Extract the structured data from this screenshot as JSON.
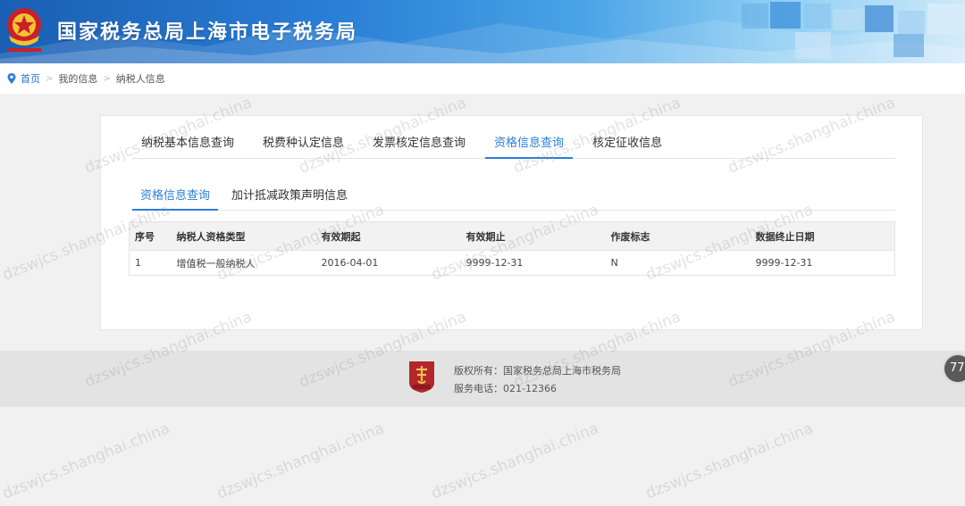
{
  "header": {
    "title": "国家税务总局上海市电子税务局",
    "emblem_icon": "tax-emblem-icon"
  },
  "breadcrumb": {
    "items": [
      "首页",
      "我的信息",
      "纳税人信息"
    ],
    "separator": ">"
  },
  "main_tabs": [
    "纳税基本信息查询",
    "税费种认定信息",
    "发票核定信息查询",
    "资格信息查询",
    "核定征收信息"
  ],
  "main_tab_active": "资格信息查询",
  "sub_tabs": [
    "资格信息查询",
    "加计抵减政策声明信息"
  ],
  "sub_tab_active": "资格信息查询",
  "table": {
    "headers": [
      "序号",
      "纳税人资格类型",
      "有效期起",
      "有效期止",
      "作废标志",
      "数据终止日期"
    ],
    "rows": [
      [
        "1",
        "增值税一般纳税人",
        "2016-04-01",
        "9999-12-31",
        "N",
        "9999-12-31"
      ]
    ]
  },
  "footer": {
    "copyright": "版权所有：国家税务总局上海市税务局",
    "phone": "服务电话：021-12366",
    "badge_icon": "tax-badge-icon"
  },
  "float_button": {
    "label": "77"
  },
  "watermark": {
    "text": "dzswjcs.shanghai.china"
  },
  "colors": {
    "accent": "#2a7fd6",
    "header_blue": "#1a5fb4",
    "footer_bg": "#e3e3e3"
  }
}
